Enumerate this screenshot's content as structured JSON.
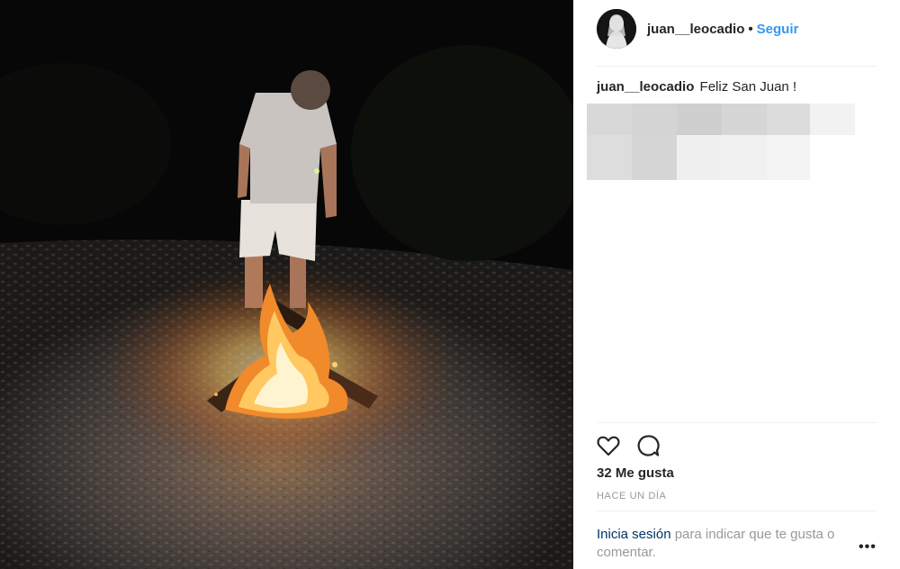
{
  "post": {
    "username": "juan__leocadio",
    "follow_label": "Seguir",
    "separator": "•",
    "caption": "Feliz San Juan !",
    "likes_label": "32 Me gusta",
    "timestamp": "HACE UN DÍA",
    "login_link": "Inicia sesión",
    "login_text": " para indicar que te gusta o comentar.",
    "more_label": "•••"
  },
  "icons": {
    "like": "heart-outline-icon",
    "comment": "comment-bubble-icon",
    "more": "more-options-icon"
  },
  "colors": {
    "accent": "#3897f0",
    "link_dark": "#003569",
    "muted": "#999999",
    "text": "#262626"
  }
}
